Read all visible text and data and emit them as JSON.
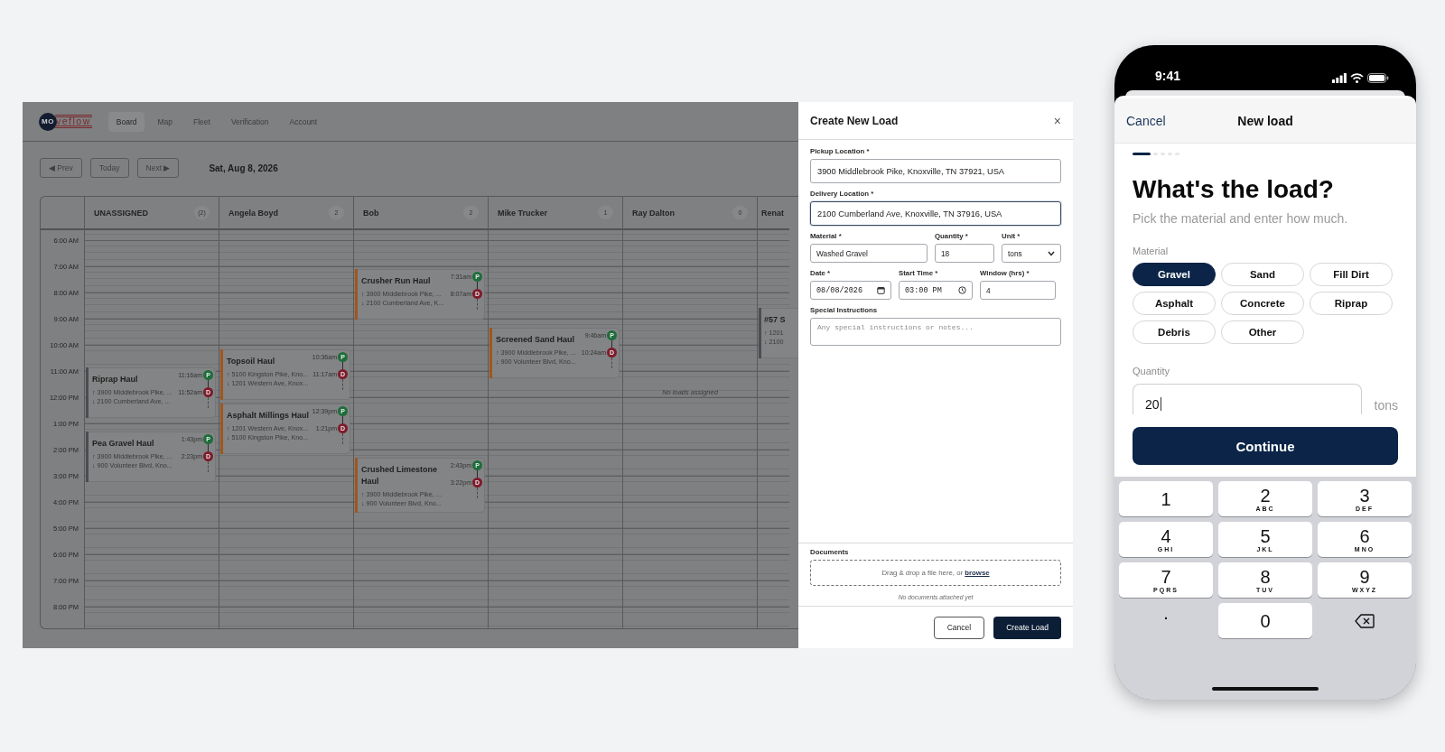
{
  "board": {
    "logo": {
      "mark": "MO",
      "word": "veflow"
    },
    "nav": [
      {
        "label": "Board",
        "selected": true
      },
      {
        "label": "Map",
        "selected": false
      },
      {
        "label": "Fleet",
        "selected": false
      },
      {
        "label": "Verification",
        "selected": false
      },
      {
        "label": "Account",
        "selected": false
      }
    ],
    "controls": {
      "prev": "◀ Prev",
      "today": "Today",
      "next": "Next ▶",
      "date": "Sat, Aug 8, 2026"
    },
    "times": [
      "6:00 AM",
      "7:00 AM",
      "8:00 AM",
      "9:00 AM",
      "10:00 AM",
      "11:00 AM",
      "12:00 PM",
      "1:00 PM",
      "2:00 PM",
      "3:00 PM",
      "4:00 PM",
      "5:00 PM",
      "6:00 PM",
      "7:00 PM",
      "8:00 PM"
    ],
    "columns": [
      {
        "name": "UNASSIGNED",
        "count": "(2)",
        "loads": [
          {
            "title": "Riprap Haul",
            "pickup": "↑ 3900 Middlebrook Pike, ...",
            "dropoff": "↓ 2100 Cumberland Ave, ...",
            "pickup_time": "11:16am",
            "dropoff_time": "11:52am",
            "pickup_badge": "P",
            "dropoff_badge": "D",
            "color": "#4a4d53"
          },
          {
            "title": "Pea Gravel Haul",
            "pickup": "↑ 3900 Middlebrook Pike, ...",
            "dropoff": "↓ 900 Volunteer Blvd, Kno...",
            "pickup_time": "1:43pm",
            "dropoff_time": "2:23pm",
            "pickup_badge": "P",
            "dropoff_badge": "D",
            "color": "#4a4d53"
          }
        ]
      },
      {
        "name": "Angela Boyd",
        "count": "2",
        "loads": [
          {
            "title": "Topsoil Haul",
            "pickup": "↑ 5100 Kingston Pike, Kno...",
            "dropoff": "↓ 1201 Western Ave, Knox...",
            "pickup_time": "10:36am",
            "dropoff_time": "11:17am",
            "pickup_badge": "P",
            "dropoff_badge": "D",
            "color": "#a0561d"
          },
          {
            "title": "Asphalt Millings Haul",
            "pickup": "↑ 1201 Western Ave, Knox...",
            "dropoff": "↓ 5100 Kingston Pike, Kno...",
            "pickup_time": "12:39pm",
            "dropoff_time": "1:21pm",
            "pickup_badge": "P",
            "dropoff_badge": "D",
            "color": "#a0561d"
          }
        ]
      },
      {
        "name": "Bob",
        "count": "2",
        "loads": [
          {
            "title": "Crusher Run Haul",
            "pickup": "↑ 3900 Middlebrook Pike, ...",
            "dropoff": "↓ 2100 Cumberland Ave, K...",
            "pickup_time": "7:31am",
            "dropoff_time": "8:07am",
            "pickup_badge": "P",
            "dropoff_badge": "D",
            "color": "#a0561d"
          },
          {
            "title": "Crushed Limestone Haul",
            "pickup": "↑ 3900 Middlebrook Pike, ...",
            "dropoff": "↓ 900 Volunteer Blvd, Kno...",
            "pickup_time": "2:43pm",
            "dropoff_time": "3:22pm",
            "pickup_badge": "P",
            "dropoff_badge": "D",
            "color": "#a0561d"
          }
        ]
      },
      {
        "name": "Mike Trucker",
        "count": "1",
        "loads": [
          {
            "title": "Screened Sand Haul",
            "pickup": "↑ 3900 Middlebrook Pike, ...",
            "dropoff": "↓ 900 Volunteer Blvd, Kno...",
            "pickup_time": "9:46am",
            "dropoff_time": "10:24am",
            "pickup_badge": "P",
            "dropoff_badge": "D",
            "color": "#a0561d"
          }
        ]
      },
      {
        "name": "Ray Dalton",
        "count": "0",
        "empty": "No loads assigned"
      },
      {
        "name": "Renat",
        "loads": [
          {
            "title": "#57 S",
            "pickup": "↑ 1201",
            "dropoff": "↓ 2100",
            "color": "#4a4d53"
          }
        ]
      }
    ]
  },
  "modal": {
    "title": "Create New Load",
    "close": "×",
    "rows": [
      {
        "fields": [
          {
            "label": "Pickup Location *",
            "value": "3900 Middlebrook Pike, Knoxville, TN 37921, USA",
            "kind": "text",
            "focused": false
          }
        ]
      },
      {
        "fields": [
          {
            "label": "Delivery Location *",
            "value": "2100 Cumberland Ave, Knoxville, TN 37916, USA",
            "kind": "text",
            "focused": true
          }
        ]
      },
      {
        "fields": [
          {
            "label": "Material *",
            "value": "Washed Gravel",
            "kind": "text",
            "focused": false
          },
          {
            "label": "Quantity *",
            "value": "18",
            "kind": "text",
            "focused": false
          },
          {
            "label": "Unit *",
            "value": "tons",
            "kind": "select",
            "focused": false
          }
        ]
      },
      {
        "fields": [
          {
            "label": "Date *",
            "value": "08/08/2026",
            "kind": "date",
            "focused": false
          },
          {
            "label": "Start Time *",
            "value": "03:00 PM",
            "kind": "time",
            "focused": false
          },
          {
            "label": "Window (hrs) *",
            "value": "4",
            "kind": "text",
            "focused": false
          }
        ]
      }
    ],
    "instructions": {
      "label": "Special Instructions",
      "placeholder": "Any special instructions or notes..."
    },
    "documents": {
      "label": "Documents",
      "prompt": "Drag & drop a file here, or ",
      "link": "browse",
      "empty": "No documents attached yet"
    },
    "buttons": [
      {
        "label": "Cancel",
        "kind": "secondary"
      },
      {
        "label": "Create Load",
        "kind": "primary"
      }
    ]
  },
  "phone": {
    "time": "9:41",
    "cancel": "Cancel",
    "title": "New load",
    "steps": [
      {
        "selected": true
      },
      {
        "selected": false
      },
      {
        "selected": false
      },
      {
        "selected": false
      },
      {
        "selected": false
      }
    ],
    "heading": "What's the load?",
    "subtitle": "Pick the material and enter how much.",
    "material_label": "Material",
    "materials": [
      {
        "label": "Gravel",
        "selected": true
      },
      {
        "label": "Sand",
        "selected": false
      },
      {
        "label": "Fill Dirt",
        "selected": false
      },
      {
        "label": "Asphalt",
        "selected": false
      },
      {
        "label": "Concrete",
        "selected": false
      },
      {
        "label": "Riprap",
        "selected": false
      },
      {
        "label": "Debris",
        "selected": false
      },
      {
        "label": "Other",
        "selected": false
      }
    ],
    "quantity_label": "Quantity",
    "quantity": "20",
    "unit": "tons",
    "continue": "Continue",
    "keys": [
      {
        "kind": "digit",
        "digit": "1"
      },
      {
        "kind": "digit",
        "digit": "2",
        "letters": "ABC"
      },
      {
        "kind": "digit",
        "digit": "3",
        "letters": "DEF"
      },
      {
        "kind": "digit",
        "digit": "4",
        "letters": "GHI"
      },
      {
        "kind": "digit",
        "digit": "5",
        "letters": "JKL"
      },
      {
        "kind": "digit",
        "digit": "6",
        "letters": "MNO"
      },
      {
        "kind": "digit",
        "digit": "7",
        "letters": "PQRS"
      },
      {
        "kind": "digit",
        "digit": "8",
        "letters": "TUV"
      },
      {
        "kind": "digit",
        "digit": "9",
        "letters": "WXYZ"
      },
      {
        "kind": "plain",
        "digit": "."
      },
      {
        "kind": "digit",
        "digit": "0"
      },
      {
        "kind": "delete"
      }
    ]
  }
}
